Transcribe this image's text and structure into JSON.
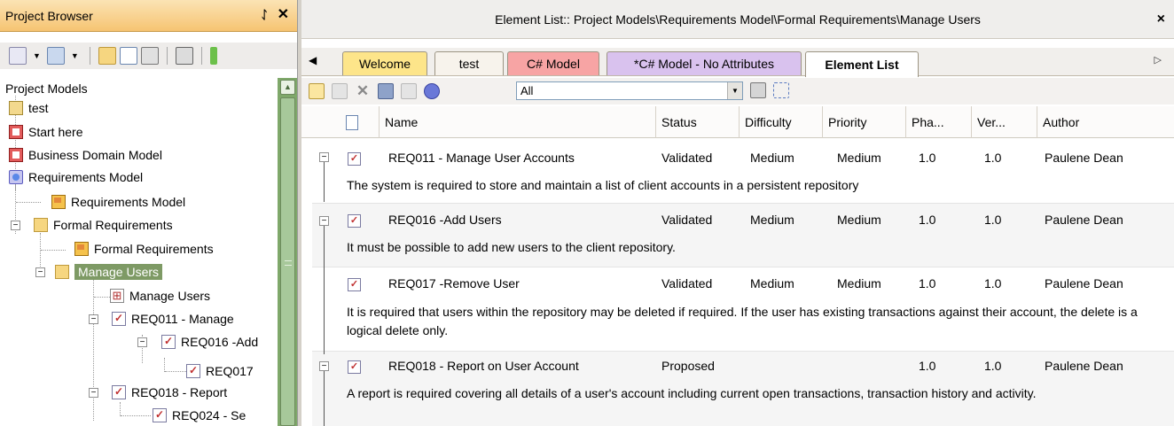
{
  "project_browser": {
    "title": "Project Browser",
    "pin_glyph": "ᛇ",
    "close_glyph": "✕",
    "tree": [
      {
        "label": "Project Models"
      },
      {
        "label": "test"
      },
      {
        "label": "Start here"
      },
      {
        "label": "Business Domain Model"
      },
      {
        "label": "Requirements Model"
      },
      {
        "label": "Requirements Model"
      },
      {
        "label": "Formal Requirements"
      },
      {
        "label": "Formal Requirements"
      },
      {
        "label": "Manage Users"
      },
      {
        "label": "Manage Users"
      },
      {
        "label": "REQ011 - Manage"
      },
      {
        "label": "REQ016 -Add"
      },
      {
        "label": "REQ017"
      },
      {
        "label": "REQ018 - Report"
      },
      {
        "label": "REQ024 - Se"
      }
    ]
  },
  "element_list": {
    "title": "Element List:: Project Models\\Requirements Model\\Formal Requirements\\Manage Users",
    "close_glyph": "×",
    "tabs": [
      {
        "label": "Welcome",
        "color": "#fde58a"
      },
      {
        "label": "test",
        "color": "#f7f3ec"
      },
      {
        "label": "C# Model",
        "color": "#f7a4a4"
      },
      {
        "label": "*C# Model - No Attributes",
        "color": "#d9c2ee"
      },
      {
        "label": "Element List",
        "color": "#ffffff"
      }
    ],
    "filter_value": "All",
    "columns": [
      "Name",
      "Status",
      "Difficulty",
      "Priority",
      "Pha...",
      "Ver...",
      "Author"
    ],
    "rows": [
      {
        "name": "REQ011 - Manage User Accounts",
        "status": "Validated",
        "difficulty": "Medium",
        "priority": "Medium",
        "phase": "1.0",
        "version": "1.0",
        "author": "Paulene Dean",
        "notes": "The system is required to store and maintain a list of client accounts in a persistent repository"
      },
      {
        "name": "REQ016 -Add Users",
        "status": "Validated",
        "difficulty": "Medium",
        "priority": "Medium",
        "phase": "1.0",
        "version": "1.0",
        "author": "Paulene Dean",
        "notes": "It must be possible to add new users to the client repository."
      },
      {
        "name": "REQ017 -Remove User",
        "status": "Validated",
        "difficulty": "Medium",
        "priority": "Medium",
        "phase": "1.0",
        "version": "1.0",
        "author": "Paulene Dean",
        "notes": "It is required that users within the repository may be deleted if required. If the user has existing transactions against their account, the delete is a logical delete only."
      },
      {
        "name": "REQ018 - Report on User Account",
        "status": "Proposed",
        "difficulty": "",
        "priority": "",
        "phase": "1.0",
        "version": "1.0",
        "author": "Paulene Dean",
        "notes": "A report is required covering all details of a user's account including current open transactions, transaction history and activity."
      }
    ]
  }
}
